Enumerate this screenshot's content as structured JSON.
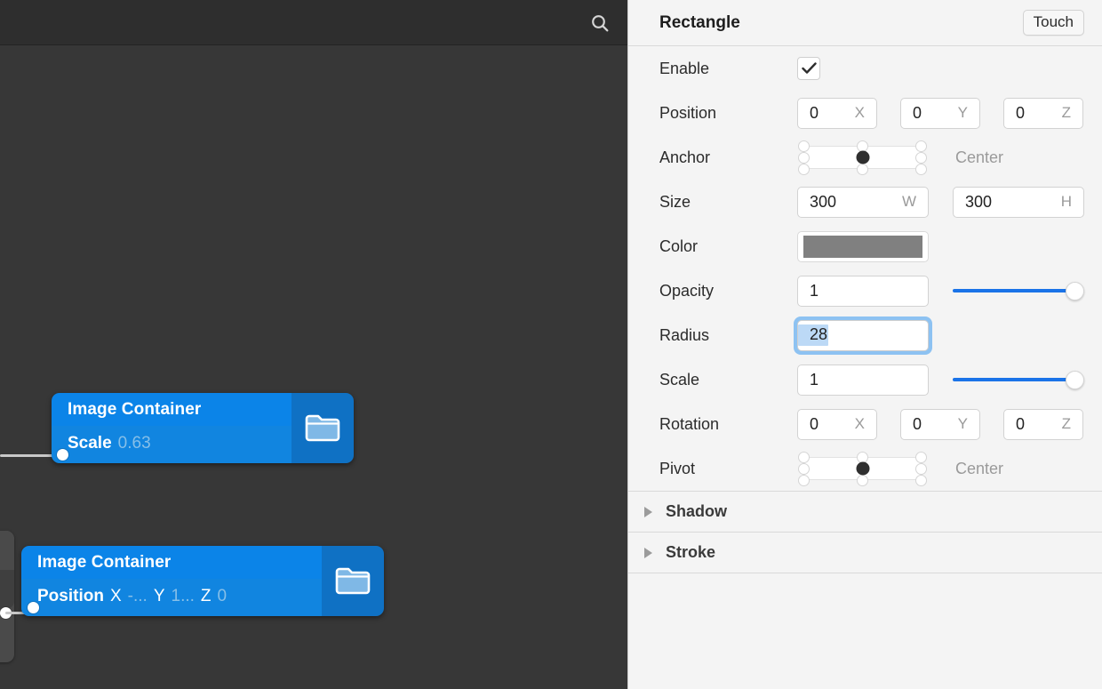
{
  "canvas": {
    "toolbar": {
      "search_icon": "search-icon"
    },
    "nodes": [
      {
        "title": "Image Container",
        "icon": "folder-icon",
        "property": {
          "name": "Scale",
          "value": "0.63"
        }
      },
      {
        "title": "Image Container",
        "icon": "folder-icon",
        "property": {
          "name": "Position",
          "axes": [
            {
              "axis": "X",
              "value": "-..."
            },
            {
              "axis": "Y",
              "value": "1..."
            },
            {
              "axis": "Z",
              "value": "0"
            }
          ]
        }
      }
    ]
  },
  "inspector": {
    "title": "Rectangle",
    "touch_label": "Touch",
    "rows": {
      "enable": {
        "label": "Enable",
        "checked": "✓"
      },
      "position": {
        "label": "Position",
        "x": "0",
        "x_suffix": "X",
        "y": "0",
        "y_suffix": "Y",
        "z": "0",
        "z_suffix": "Z"
      },
      "anchor": {
        "label": "Anchor",
        "value": "Center"
      },
      "size": {
        "label": "Size",
        "w": "300",
        "w_suffix": "W",
        "h": "300",
        "h_suffix": "H"
      },
      "color": {
        "label": "Color",
        "swatch_hex": "#808080"
      },
      "opacity": {
        "label": "Opacity",
        "value": "1",
        "slider_percent": 100
      },
      "radius": {
        "label": "Radius",
        "value": "28"
      },
      "scale": {
        "label": "Scale",
        "value": "1",
        "slider_percent": 100
      },
      "rotation": {
        "label": "Rotation",
        "x": "0",
        "x_suffix": "X",
        "y": "0",
        "y_suffix": "Y",
        "z": "0",
        "z_suffix": "Z"
      },
      "pivot": {
        "label": "Pivot",
        "value": "Center"
      }
    },
    "sections": [
      {
        "label": "Shadow"
      },
      {
        "label": "Stroke"
      }
    ]
  },
  "colors": {
    "accent_blue": "#1a73e8",
    "node_blue": "#1185e0",
    "node_title_blue": "#0b84e8",
    "canvas_bg": "#373737",
    "toolbar_bg": "#2e2e2e",
    "panel_bg": "#f4f4f4"
  }
}
